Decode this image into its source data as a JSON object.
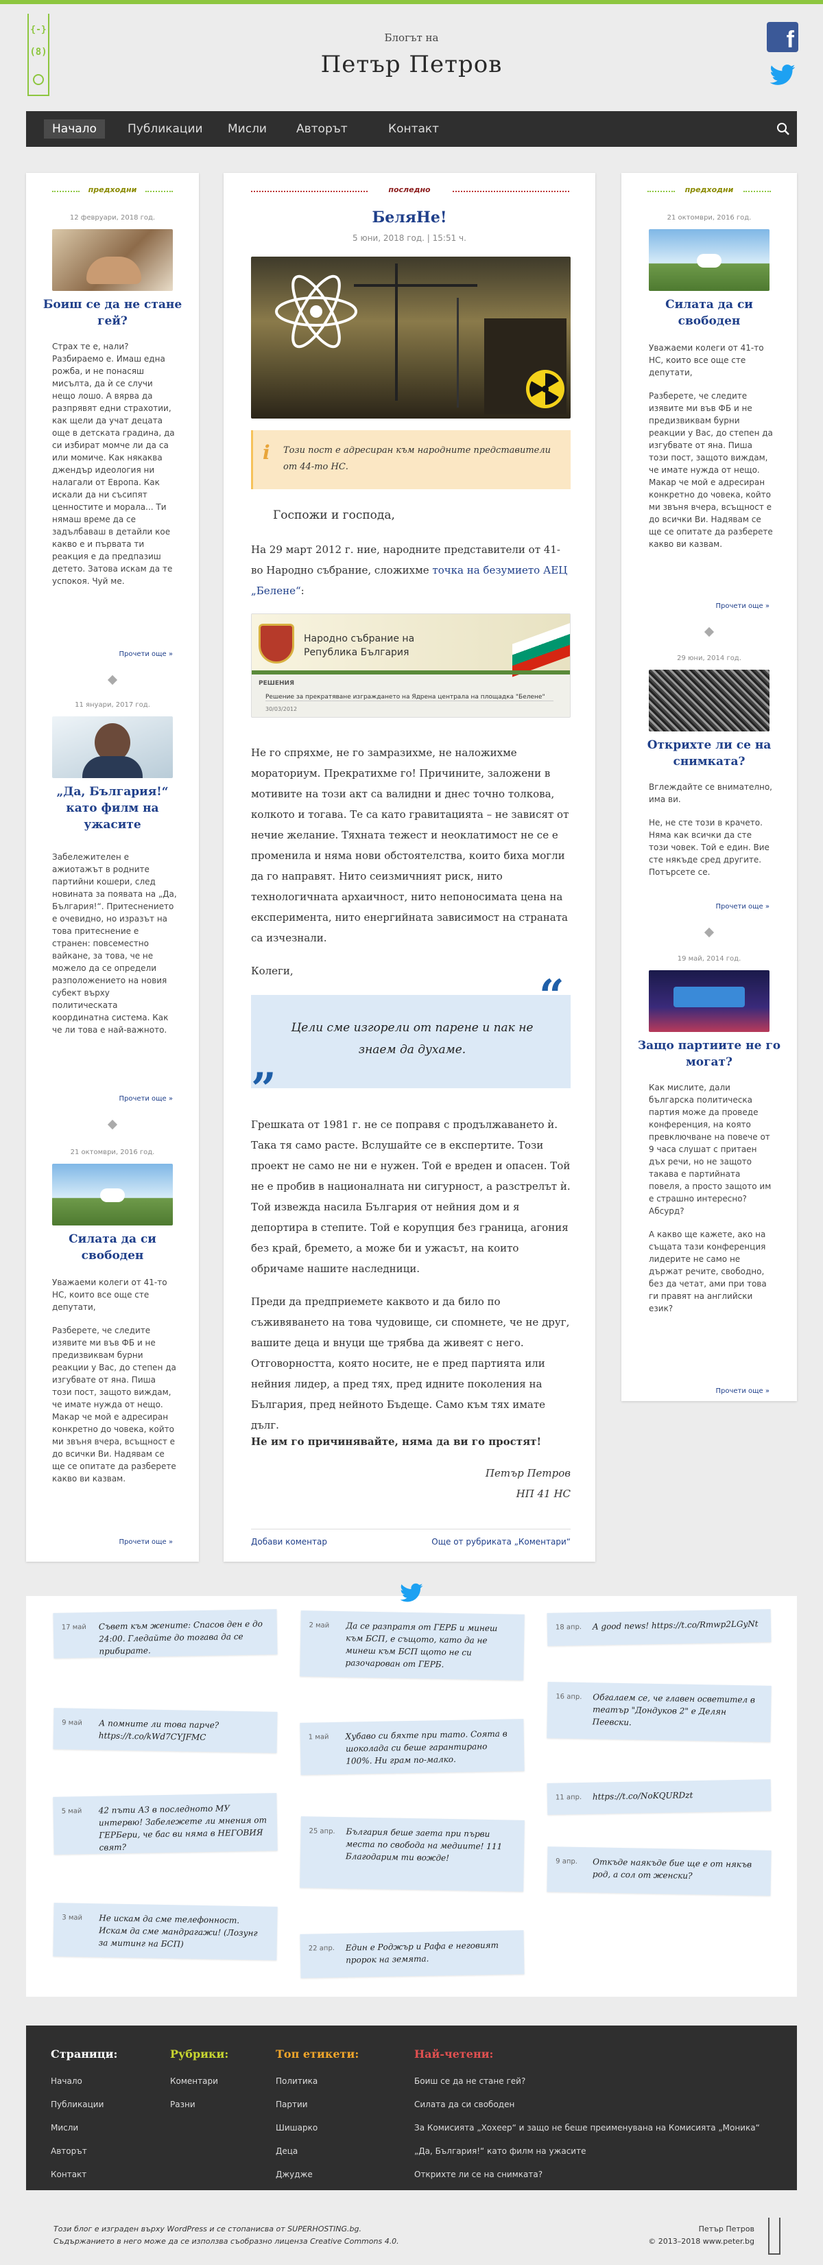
{
  "header": {
    "logo_top": "{-}",
    "logo_mid": "(8)",
    "pretitle": "Блогът на",
    "title": "Петър Петров",
    "facebook_icon": "facebook-icon",
    "twitter_icon": "twitter-icon"
  },
  "nav": {
    "items": [
      "Начало",
      "Публикации",
      "Мисли",
      "Авторът",
      "Контакт"
    ],
    "active": "Начало"
  },
  "left": {
    "label": "предходни",
    "posts": [
      {
        "date": "12 февруари, 2018 год.",
        "title": "Боиш се да не стане гей?",
        "body": "Страх те е, нали? Разбираемо е. Имаш една рожба, и не понасяш мисълта, да ѝ се случи нещо лошо. А вярва да разпрявят едни страхотии, как щели да учат децата още в детската градина, да си избират момче ли да са или момиче. Как някаква джендър идеология ни налагали от Европа. Как искали да ни съсипят ценностите и морала... Ти нямаш време да се задълбаваш в детайли кое какво е и първата ти реакция е да предпазиш детето. Затова искам да те успокоя. Чуй ме.",
        "more": "Прочети още »"
      },
      {
        "date": "11 януари, 2017 год.",
        "title": "„Да, България!“ като филм на ужасите",
        "body": "Забележителен е ажиотажът в родните партийни кошери, след новината за появата на „Да, България!“. Притеснението е очевидно, но изразът на това притеснение е странен: повсеместно вайкане, за това, че не можело да се определи разположението на новия субект върху политическата координатна система. Как че ли това е най-важното.",
        "more": "Прочети още »"
      },
      {
        "date": "21 октомври, 2016 год.",
        "title": "Силата да си свободен",
        "body1": "Уважаеми колеги от 41-то НС, които все още сте депутати,",
        "body2": "Разберете, че следите изявите ми във ФБ и не предизвиквам бурни реакции у Вас, до степен да изгубвате от яна. Пиша този пост, защото виждам, че имате нужда от нещо. Макар че мой е адресиран конкретно до човека, който ми звъня вчера, всъщност е до всички Ви. Надявам се ще се опитате да разберете какво ви казвам.",
        "more": "Прочети още »"
      }
    ]
  },
  "main": {
    "label": "последно",
    "title": "БеляНе!",
    "date": "5 юни, 2018 год. | 15:51 ч.",
    "notice": "Този пост е адресиран към народните представители от 44-то НС.",
    "notice_icon": "info-icon",
    "greeting": "Госпожи и господа,",
    "p1_before": "На 29 март 2012 г. ние, народните представители от 41-во Народно събрание, сложихме ",
    "p1_link": "точка на безумието АЕЦ „Белене“",
    "p1_after": ":",
    "decision_header": "Народно събрание на Република България",
    "decision_label": "РЕШЕНИЯ",
    "decision_text": "Решение за прекратяване изграждането на Ядрена централа на площадка \"Белене\"",
    "decision_date": "30/03/2012",
    "p2": "Не го спряхме, не го замразихме, не наложихме мораториум. Прекратихме го! Причините, заложени в мотивите на този акт са валидни и днес точно толкова, колкото и тогава. Те са като гравитацията – не зависят от нечие желание. Тяхната тежест и неоклатимост не се е променила и няма нови обстоятелства, които биха могли да го направят. Нито сеизмичният риск, нито технологичната архаичност, нито непоносимата цена на експеримента, нито енергийната зависимост на страната са изчезнали.",
    "colleagues": "Колеги,",
    "quote": "Цели сме изгорели от парене и пак не знаем да духаме.",
    "p3": "Грешката от 1981 г. не се поправя с продължаването ѝ. Така тя само расте. Вслушайте се в експертите. Този проект не само не ни е нужен. Той е вреден и опасен. Той не е пробив в националната ни сигурност, а разстрелът ѝ. Той извежда насила България от нейния дом и я депортира в степите. Той е корупция без граница, агония без край, бремето, а може би и ужасът, на които обричаме нашите наследници.",
    "p4": "Преди да предприемете каквото и да било по съживяването на това чудовище, си спомнете, че не друг, вашите деца и внуци ще трябва да живеят с него. Отговорността, която носите, не е пред партията или нейния лидер, а пред тях, пред идните поколения на България, пред нейното Бъдеще. Само към тях имате дълг.",
    "p5": "Не им го причинявайте, няма да ви го простят!",
    "sign_name": "Петър Петров",
    "sign_role": "НП 41 НС",
    "add_comment": "Добави коментар",
    "more_from": "Още от рубриката „Коментари“"
  },
  "right": {
    "label": "предходни",
    "posts": [
      {
        "date": "21 октомври, 2016 год.",
        "title": "Силата да си свободен",
        "body1": "Уважаеми колеги от 41-то НС, които все още сте депутати,",
        "body2": "Разберете, че следите изявите ми във ФБ и не предизвиквам бурни реакции у Вас, до степен да изгубвате от яна. Пиша този пост, защото виждам, че имате нужда от нещо. Макар че мой е адресиран конкретно до човека, който ми звъня вчера, всъщност е до всички Ви. Надявам се ще се опитате да разберете какво ви казвам.",
        "more": "Прочети още »"
      },
      {
        "date": "29 юни, 2014 год.",
        "title": "Открихте ли се на снимката?",
        "body1": "Вглеждайте се внимателно, има ви.",
        "body2": "Не, не сте този в крачето. Няма как всички да сте този човек. Той е един. Вие сте някъде сред другите. Потърсете се.",
        "more": "Прочети още »"
      },
      {
        "date": "19 май, 2014 год.",
        "title": "Защо партиите не го могат?",
        "body1": "Как мислите, дали българска политическа партия може да проведе конференция, на която превключване на повече от 9 часа слушат с притаен дъх речи, но не защото такава е партийната повеля, а просто защото им е страшно интересно? Абсурд?",
        "body2": "А какво ще кажете, ако на същата тази конференция лидерите не само не държат речите, свободно, без да четат, ами при това ги правят на английски език?",
        "more": "Прочети още »"
      }
    ]
  },
  "tweets": [
    {
      "date": "17 май",
      "text": "Съвет към жените: Спасов ден е до 24:00. Гледайте до тогава да се прибирате."
    },
    {
      "date": "9 май",
      "text": "А помните ли това парче? https://t.co/kWd7CYJFMC"
    },
    {
      "date": "5 май",
      "text": "42 пъти АЗ в последното МУ интервю! Забележете ли мнения от ГЕРБери, че бас ви няма в НЕГОВИЯ свят?"
    },
    {
      "date": "3 май",
      "text": "Не искам да сме телефонност. Искам да сме мандрагажи! (Лозунг за митинг на БСП)"
    },
    {
      "date": "2 май",
      "text": "Да се разпратя от ГЕРБ и минеш към БСП, е същото, като да не минеш към БСП щото не си разочарован от ГЕРБ."
    },
    {
      "date": "1 май",
      "text": "Хубаво си бяхте при тато. Соята в шоколада си беше гарантирано 100%. Ни грам по-малко."
    },
    {
      "date": "25 апр.",
      "text": "България беше заета при първи места по свобода на медиите! 111 Благодарим ти вожде!"
    },
    {
      "date": "22 апр.",
      "text": "Един е Роджър и Рафа е неговият пророк на земята."
    },
    {
      "date": "18 апр.",
      "text": "A good news! https://t.co/Rmwp2LGyNt"
    },
    {
      "date": "16 апр.",
      "text": "Обгалаем се, че главен осветител в театър \"Дондуков 2\" е Делян Пеевски."
    },
    {
      "date": "11 апр.",
      "text": "https://t.co/NoKQURDzt"
    },
    {
      "date": "9 апр.",
      "text": "Откъде наякъде бие ще е от някъв род, а сол от женски?"
    }
  ],
  "footer": {
    "pages_title": "Страници:",
    "pages": [
      "Начало",
      "Публикации",
      "Мисли",
      "Авторът",
      "Контакт"
    ],
    "rubrics_title": "Рубрики:",
    "rubrics": [
      "Коментари",
      "Разни"
    ],
    "tags_title": "Топ етикети:",
    "tags": [
      "Политика",
      "Партии",
      "Шишарко",
      "Деца",
      "Джудже"
    ],
    "popular_title": "Най-четени:",
    "popular": [
      "Боиш се да не стане гей?",
      "Силата да си свободен",
      "За Комисията „Хохеер“ и защо не беше преименувана на Комисията „Моника“",
      "„Да, България!“ като филм на ужасите",
      "Открихте ли се на снимката?"
    ],
    "colors": {
      "pages": "#ffffff",
      "rubrics": "#c8d630",
      "tags": "#f0a52a",
      "popular": "#e05050"
    }
  },
  "bottom": {
    "line1": "Този блог е изграден върху WordPress и се стопанисва от SUPERHOSTING.bg.",
    "line2": "Съдържанието в него може да се използва съобразно лиценза Creative Commons 4.0.",
    "name": "Петър Петров",
    "copyright": "© 2013–2018 www.peter.bg"
  }
}
